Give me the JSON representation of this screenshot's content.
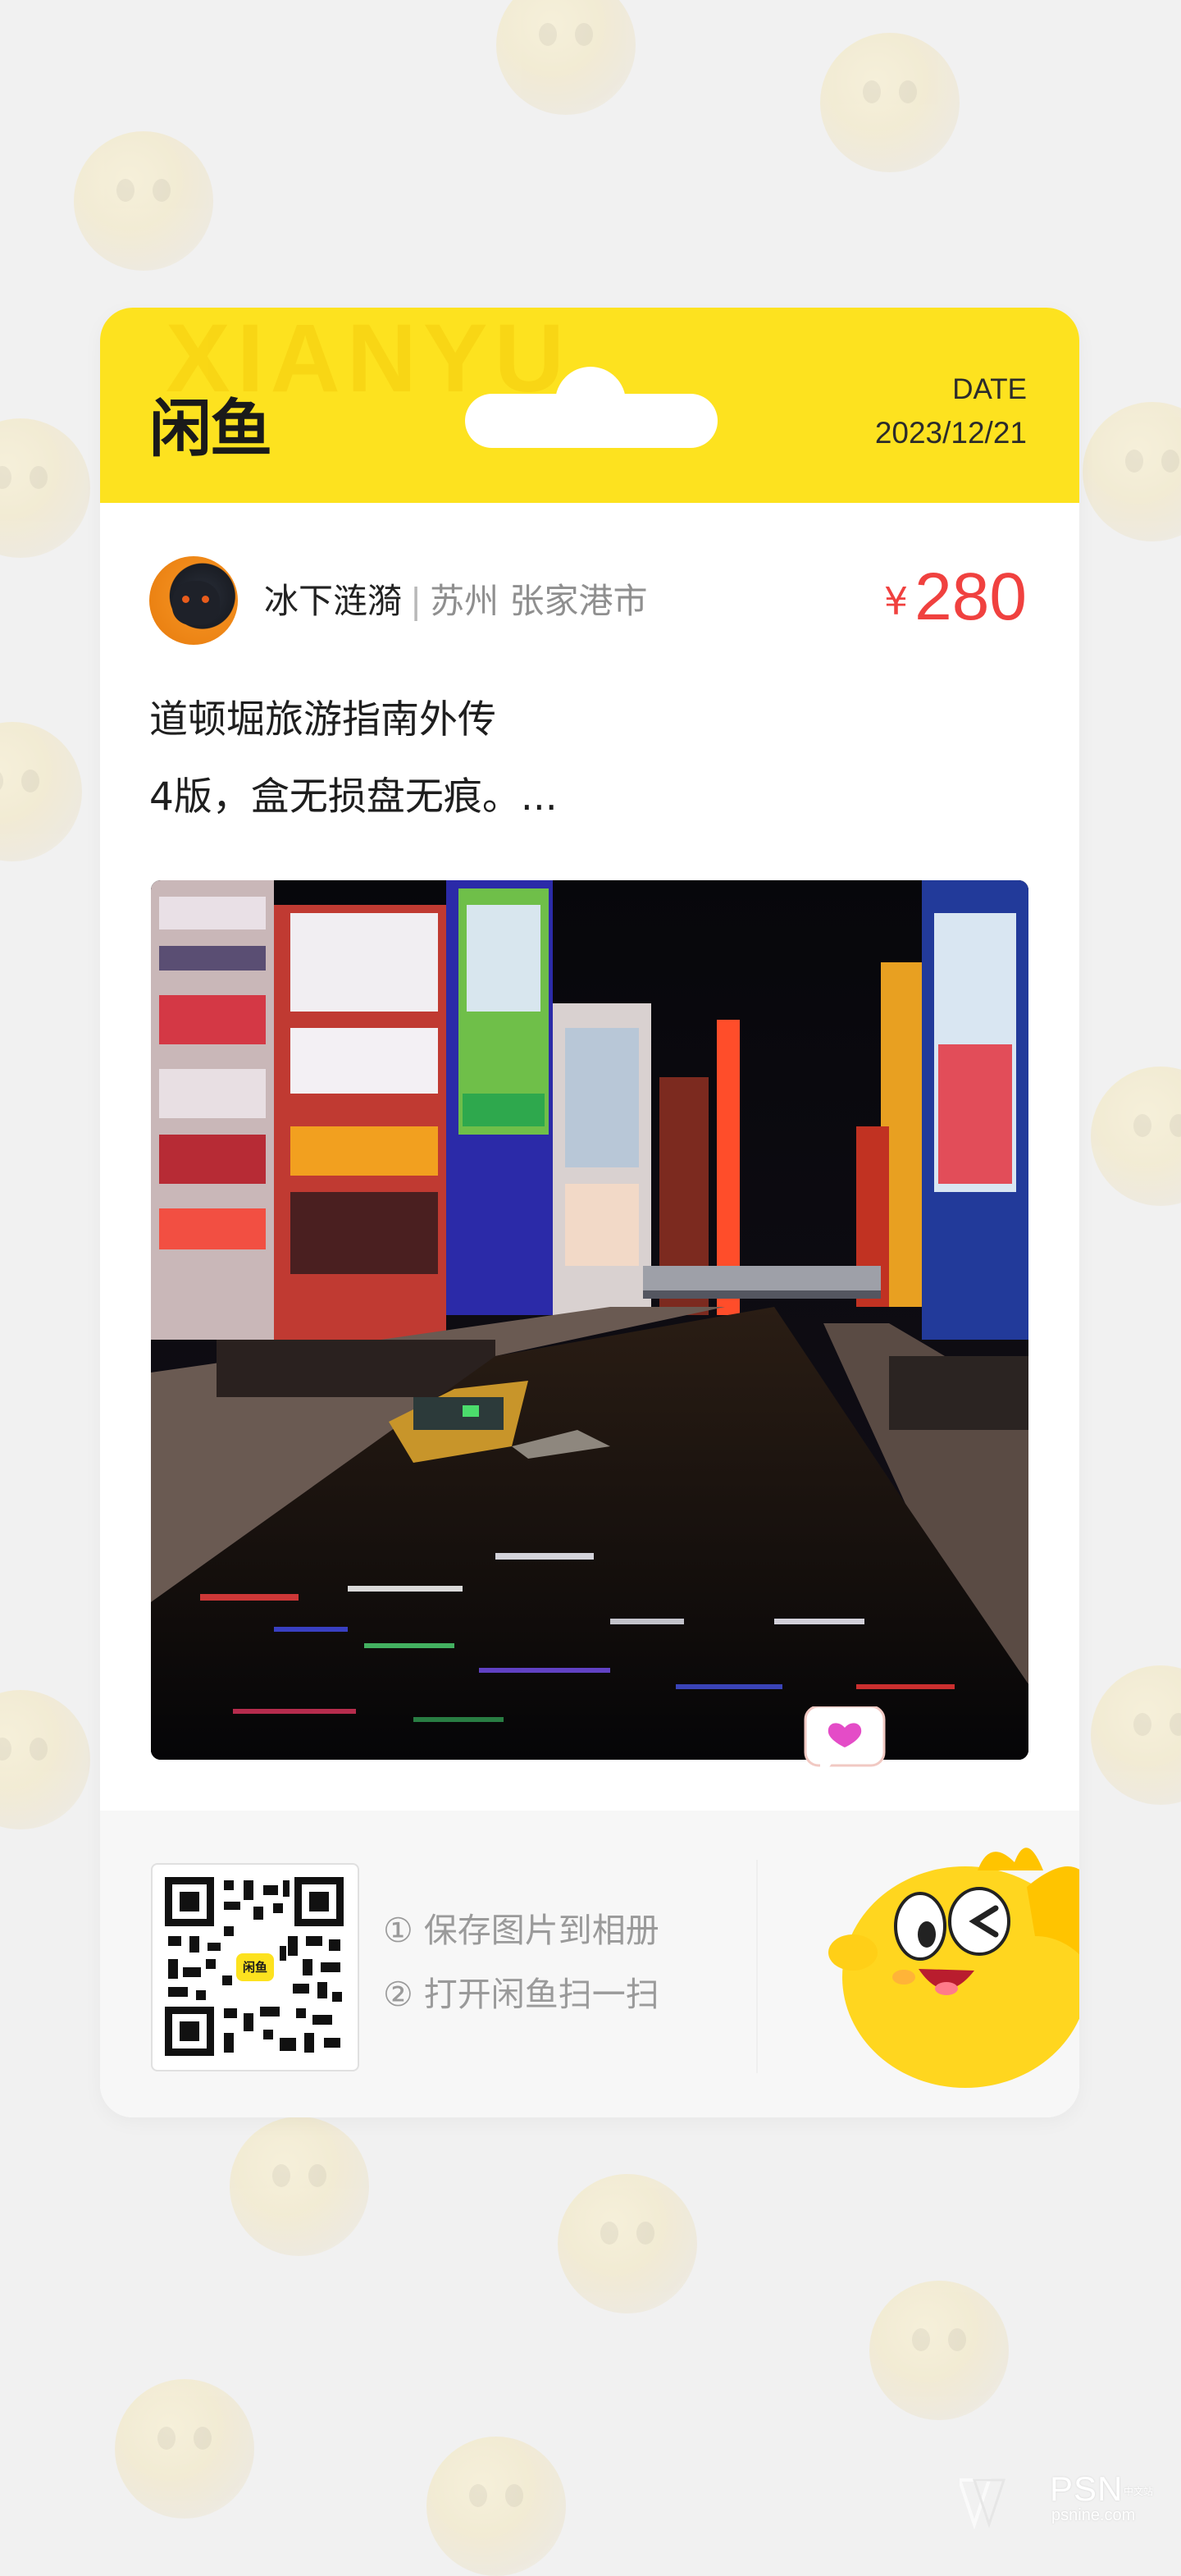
{
  "header": {
    "watermark": "XIANYU",
    "logo": "闲鱼",
    "date_label": "DATE",
    "date_value": "2023/12/21"
  },
  "seller": {
    "name": "冰下涟漪",
    "separator": "|",
    "location": "苏州 张家港市"
  },
  "price": {
    "symbol": "¥",
    "value": "280"
  },
  "description": {
    "line1": "道顿堀旅游指南外传",
    "line2": "4版，盒无损盘无痕。..."
  },
  "footer": {
    "qr_badge": "闲鱼",
    "step1": "① 保存图片到相册",
    "step2": "② 打开闲鱼扫一扫"
  },
  "watermark_brand": {
    "name": "PSN",
    "cn": "中文站",
    "url": "psnine.com"
  },
  "colors": {
    "brand_yellow": "#fde21f",
    "price_red": "#f0413f",
    "background": "#f1f1f1"
  },
  "icons": {
    "avatar": "black-cat-avatar-icon",
    "mascot": "xianyu-fish-mascot-icon",
    "heart": "heart-bubble-icon",
    "qr": "qr-code-icon"
  }
}
